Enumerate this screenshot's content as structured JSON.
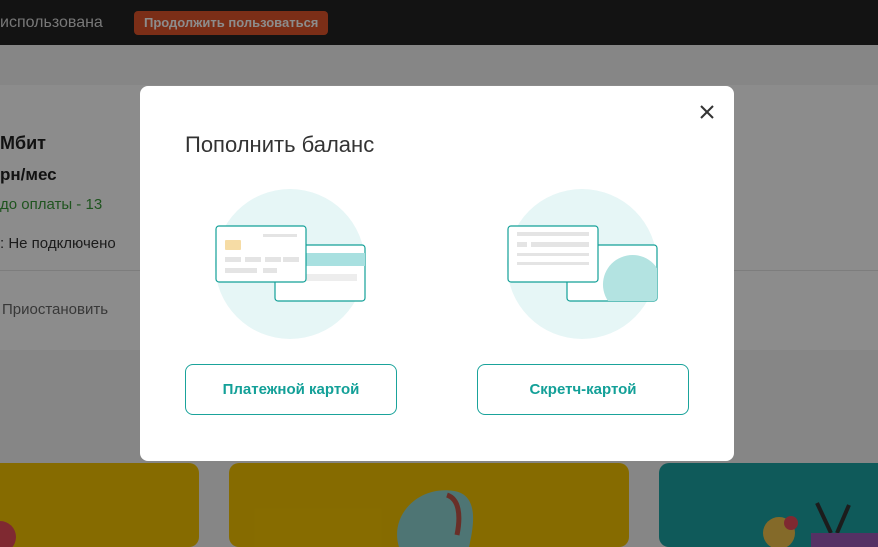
{
  "topbar": {
    "notice_text": "использована",
    "continue_label": "Продолжить пользоваться"
  },
  "tariff": {
    "speed": "Мбит",
    "price": "рн/мес",
    "due": "до оплаты - 13",
    "status": ": Не подключено",
    "pause_label": "Приостановить"
  },
  "modal": {
    "title": "Пополнить баланс",
    "close_icon": "close-icon",
    "options": [
      {
        "label": "Платежной картой",
        "icon": "bank-card-icon"
      },
      {
        "label": "Скретч-картой",
        "icon": "scratch-card-icon"
      }
    ]
  },
  "colors": {
    "accent": "#13a098",
    "topbar": "#232323",
    "continue_button": "#e0542a",
    "due_text": "#3a9a3a",
    "promo_yellow": "#f5c400",
    "promo_teal": "#1ca4a4"
  }
}
